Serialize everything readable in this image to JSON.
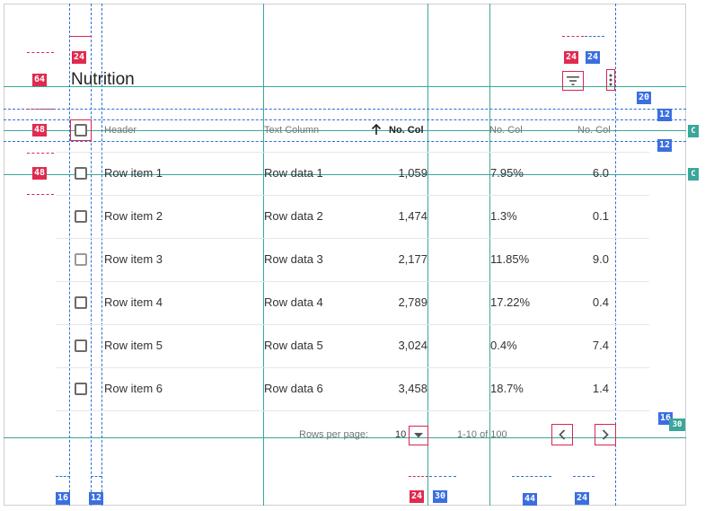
{
  "table": {
    "title": "Nutrition",
    "headers": {
      "name": "Header",
      "text": "Text Column",
      "sorted_col": "No. Col",
      "col2": "No. Col",
      "col3": "No. Col"
    },
    "rows": [
      {
        "name": "Row item 1",
        "text": "Row data 1",
        "num": "1,059",
        "pct": "7.95%",
        "val": "6.0"
      },
      {
        "name": "Row item 2",
        "text": "Row data 2",
        "num": "1,474",
        "pct": "1.3%",
        "val": "0.1"
      },
      {
        "name": "Row item 3",
        "text": "Row data 3",
        "num": "2,177",
        "pct": "11.85%",
        "val": "9.0"
      },
      {
        "name": "Row item 4",
        "text": "Row data 4",
        "num": "2,789",
        "pct": "17.22%",
        "val": "0.4"
      },
      {
        "name": "Row item 5",
        "text": "Row data 5",
        "num": "3,024",
        "pct": "0.4%",
        "val": "7.4"
      },
      {
        "name": "Row item 6",
        "text": "Row data 6",
        "num": "3,458",
        "pct": "18.7%",
        "val": "1.4"
      }
    ],
    "pagination": {
      "rows_per_page_label": "Rows per page:",
      "rows_per_page_value": "10",
      "range": "1-10 of 100"
    }
  },
  "specs": {
    "toolbar_height": "64",
    "header_row_height": "48",
    "row_height": "48",
    "checkbox_size": "24",
    "icon_size_a": "24",
    "icon_size_b": "24",
    "top_margin_icons": "20",
    "header_gap_top": "12",
    "header_gap_bottom": "12",
    "footer_gap": "16",
    "footer_side": "30",
    "left_margin": "16",
    "checkbox_gap": "12",
    "dropdown_size": "24",
    "dropdown_gap": "30",
    "range_gap": "44",
    "chevron_size": "24",
    "teal_marker": "C"
  },
  "icons": {
    "filter": "filter-list-icon",
    "more": "more-vert-icon",
    "sort": "arrow-upward-icon",
    "dropdown": "arrow-drop-down-icon",
    "prev": "chevron-left-icon",
    "next": "chevron-right-icon"
  },
  "colors": {
    "guide_teal": "#3aa79a",
    "spec_red": "#e02a4f",
    "spec_blue": "#3b6fe0"
  }
}
